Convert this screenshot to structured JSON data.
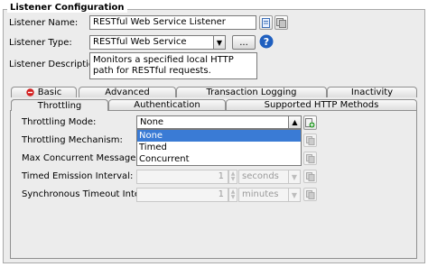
{
  "group_title": "Listener Configuration",
  "fields": {
    "name": {
      "label": "Listener Name:",
      "value": "RESTful Web Service Listener"
    },
    "type": {
      "label": "Listener Type:",
      "value": "RESTful Web Service",
      "browse_label": "..."
    },
    "description": {
      "label": "Listener Description:",
      "value": "Monitors a specified local HTTP path for RESTful requests."
    }
  },
  "tabs_row1": [
    {
      "label": "Basic",
      "has_error_icon": true
    },
    {
      "label": "Advanced"
    },
    {
      "label": "Transaction Logging"
    },
    {
      "label": "Inactivity"
    }
  ],
  "tabs_row2": [
    {
      "label": "Throttling",
      "active": true
    },
    {
      "label": "Authentication"
    },
    {
      "label": "Supported HTTP Methods"
    }
  ],
  "throttling": {
    "mode": {
      "label": "Throttling Mode:",
      "value": "None"
    },
    "mechanism": {
      "label": "Throttling Mechanism:"
    },
    "max_messages": {
      "label": "Max Concurrent Messages:"
    },
    "timed_interval": {
      "label": "Timed Emission Interval:",
      "value": "1",
      "unit": "seconds"
    },
    "sync_timeout": {
      "label": "Synchronous Timeout Interval:",
      "value": "1",
      "unit": "minutes"
    }
  },
  "dropdown_options": [
    "None",
    "Timed",
    "Concurrent"
  ],
  "dropdown_selected": "None",
  "colors": {
    "selection": "#3a7bd5",
    "help_icon": "#1f5fbf",
    "error_icon": "#d32020",
    "add_icon": "#2e9e2e"
  }
}
